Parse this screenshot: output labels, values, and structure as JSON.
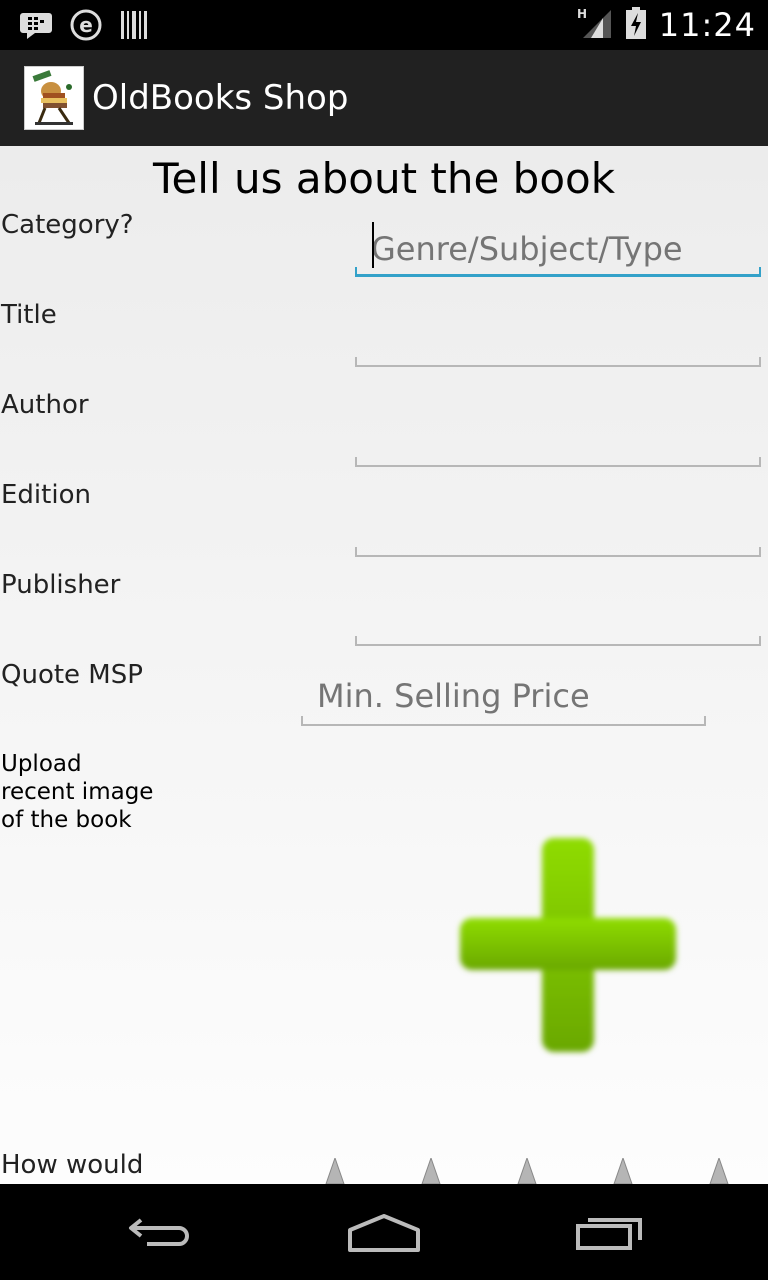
{
  "status_bar": {
    "time": "11:24",
    "network_type": "H",
    "icons": [
      "bbm-icon",
      "e-icon",
      "barcode-icon",
      "signal-icon",
      "battery-charging-icon"
    ]
  },
  "action_bar": {
    "title": "OldBooks Shop",
    "icon": "app-logo-icon"
  },
  "form": {
    "heading": "Tell us about the book",
    "category": {
      "label": "Category?",
      "placeholder": "Genre/Subject/Type",
      "value": ""
    },
    "title": {
      "label": "Title",
      "placeholder": "",
      "value": ""
    },
    "author": {
      "label": "Author",
      "placeholder": "",
      "value": ""
    },
    "edition": {
      "label": "Edition",
      "placeholder": "",
      "value": ""
    },
    "publisher": {
      "label": "Publisher",
      "placeholder": "",
      "value": ""
    },
    "msp": {
      "label": "Quote MSP",
      "placeholder": "Min. Selling Price",
      "value": ""
    },
    "upload": {
      "label_lines": [
        "Upload",
        "recent image",
        "of the book"
      ],
      "button_icon": "green-plus-icon"
    },
    "rating": {
      "label": "How would",
      "stars": 5,
      "value": 0
    }
  },
  "nav_bar": {
    "icons": [
      "back-icon",
      "home-icon",
      "recents-icon"
    ]
  },
  "colors": {
    "accent": "#33a1c9",
    "action_bar": "#212121",
    "plus_green": "#7cc400"
  }
}
